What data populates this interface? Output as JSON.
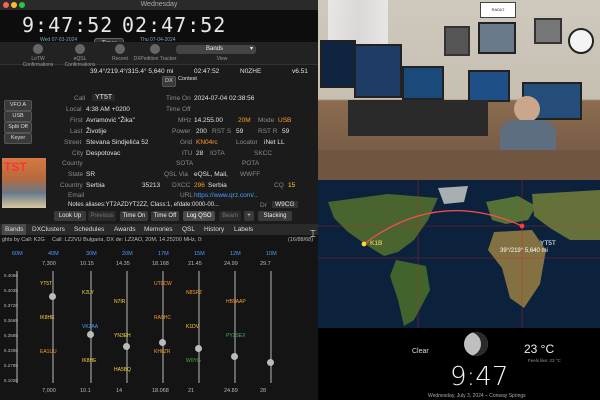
{
  "window": {
    "title": "Wednesday"
  },
  "clocks": {
    "local_time": "9:47:52",
    "utc_time": "02:47:52",
    "local_date": "Wed 07-03-2024",
    "utc_date": "Thu 07-04-2024",
    "timer_label": "Timer"
  },
  "toolbar": {
    "items": [
      "LoTW Confirmations",
      "eQSL Confirmations",
      "Recent",
      "DXPedition Tracker",
      "View"
    ],
    "bands_button": "Bands"
  },
  "status": {
    "coords": "39.4°/219.4°/315.4° 5,640 mi",
    "time": "02:47:52",
    "callsign": "N0ZHE",
    "version": "v6.51",
    "dx": "DX",
    "contest": "Contest"
  },
  "side_controls": {
    "vfo": "VFO A",
    "mode": "USB",
    "split": "Split Off",
    "keyer": "Keyer"
  },
  "log": {
    "call_label": "Call",
    "call": "YT5T",
    "local_label": "Local",
    "local": "4:38 AM +0200",
    "first_label": "First",
    "first": "Avramović \"Žika\"",
    "last_label": "Last",
    "last": "Životije",
    "street_label": "Street",
    "street": "Stevana Sindjelića 52",
    "city_label": "City",
    "city": "Despotovac",
    "county_label": "County",
    "state_label": "State",
    "state": "SR",
    "country_label": "Country",
    "country": "Serbia",
    "zip": "35213",
    "email_label": "Email",
    "notes": "Notes aliases:YT2AZDYT2ZZ, Class:1, efdate:0000-00...",
    "time_on_label": "Time On",
    "time_on": "2024-07-04 02:38:56",
    "time_off_label": "Time Off",
    "mhz_label": "MHz",
    "mhz": "14.255.00",
    "band": "20M",
    "mode_label": "Mode",
    "mode": "USB",
    "power_label": "Power",
    "power": "200",
    "rsts_label": "RST S",
    "rsts": "59",
    "rstr_label": "RST R",
    "rstr": "59",
    "grid_label": "Grid",
    "grid": "KN04rc",
    "locator_label": "Locator",
    "locator": "iNet LL",
    "itu_label": "ITU",
    "itu": "28",
    "iota_label": "IOTA",
    "skcc_label": "SKCC",
    "sota_label": "SOTA",
    "pota_label": "POTA",
    "qslvia_label": "QSL Via",
    "qslvia": "eQSL, Mail,",
    "wwff_label": "WWFF",
    "dxcc_label": "DXCC",
    "dxcc": "296",
    "dxcc_name": "Serbia",
    "cq_label": "CQ",
    "cq": "15",
    "url_label": "URL",
    "url": "https://www.qrz.com/..",
    "dr_label": "Dr",
    "dr": "W9CG"
  },
  "log_buttons": [
    "Look Up",
    "Previous",
    "Time On",
    "Time Off",
    "Log QSO",
    "Beam",
    "Stacking"
  ],
  "tabs": [
    "Bands",
    "DXClusters",
    "Schedules",
    "Awards",
    "Memories",
    "QSL",
    "History",
    "Labels"
  ],
  "band_grid": {
    "header": "ghts by Call: K2G",
    "header2": "Call: LZ2VU Bulgaria, DX de: LZ2AO, 20M, 14.25200 MHz, 0:",
    "count": "(16/88/68)",
    "bands": [
      "60M",
      "40M",
      "30M",
      "20M",
      "17M",
      "15M",
      "12M",
      "10M"
    ],
    "top_freqs": [
      "7,300",
      "10.15",
      "14.35",
      "18.168",
      "21.45",
      "24.99",
      "29.7"
    ],
    "bottom_freqs": [
      "7,000",
      "10.1",
      "14",
      "18.068",
      "21",
      "24.89",
      "28"
    ],
    "left_freqs": [
      "5.4066",
      "5.4035",
      "5.3720",
      "5.3665",
      "5.3585",
      "5.3300",
      "5.2785",
      "5.1020"
    ],
    "spots": [
      {
        "text": "YT5T",
        "color": "#ffd23a"
      },
      {
        "text": "K2LY",
        "color": "#ffd23a"
      },
      {
        "text": "N7IR",
        "color": "#ffd23a"
      },
      {
        "text": "UT0CW",
        "color": "#ff9a2a"
      },
      {
        "text": "N8SPZ",
        "color": "#ff9a2a"
      },
      {
        "text": "HB9AAP",
        "color": "#ff9a2a"
      },
      {
        "text": "IK8HE",
        "color": "#ffd23a"
      },
      {
        "text": "VK2AA",
        "color": "#4a9cff"
      },
      {
        "text": "YN3EH",
        "color": "#ffd23a"
      },
      {
        "text": "RA9HC",
        "color": "#ff9a2a"
      },
      {
        "text": "K1DV",
        "color": "#ffd23a"
      },
      {
        "text": "PY2SEX",
        "color": "#4caf50"
      },
      {
        "text": "EA1UU",
        "color": "#ff9a2a"
      },
      {
        "text": "IK8HE",
        "color": "#ffd23a"
      },
      {
        "text": "HA5BQ",
        "color": "#ffd23a"
      },
      {
        "text": "KH6ZR",
        "color": "#ff9a2a"
      },
      {
        "text": "W0YG",
        "color": "#4caf50"
      }
    ]
  },
  "webcam": {
    "sign": "RADIO OPERATOR"
  },
  "map": {
    "home_label": "K1B",
    "dx_label": "YT5T",
    "dx_info": "39°/219° 5,640 mi"
  },
  "weather": {
    "condition": "Clear",
    "temp": "23 °C",
    "feels": "Feels like: 23 °C",
    "time": "9:47",
    "date": "Wednesday, July 3, 2024 – Conway Springs"
  },
  "colors": {
    "accent_blue": "#4a9cff",
    "band_orange": "#ff9a2a",
    "spot_yellow": "#ffd23a"
  }
}
